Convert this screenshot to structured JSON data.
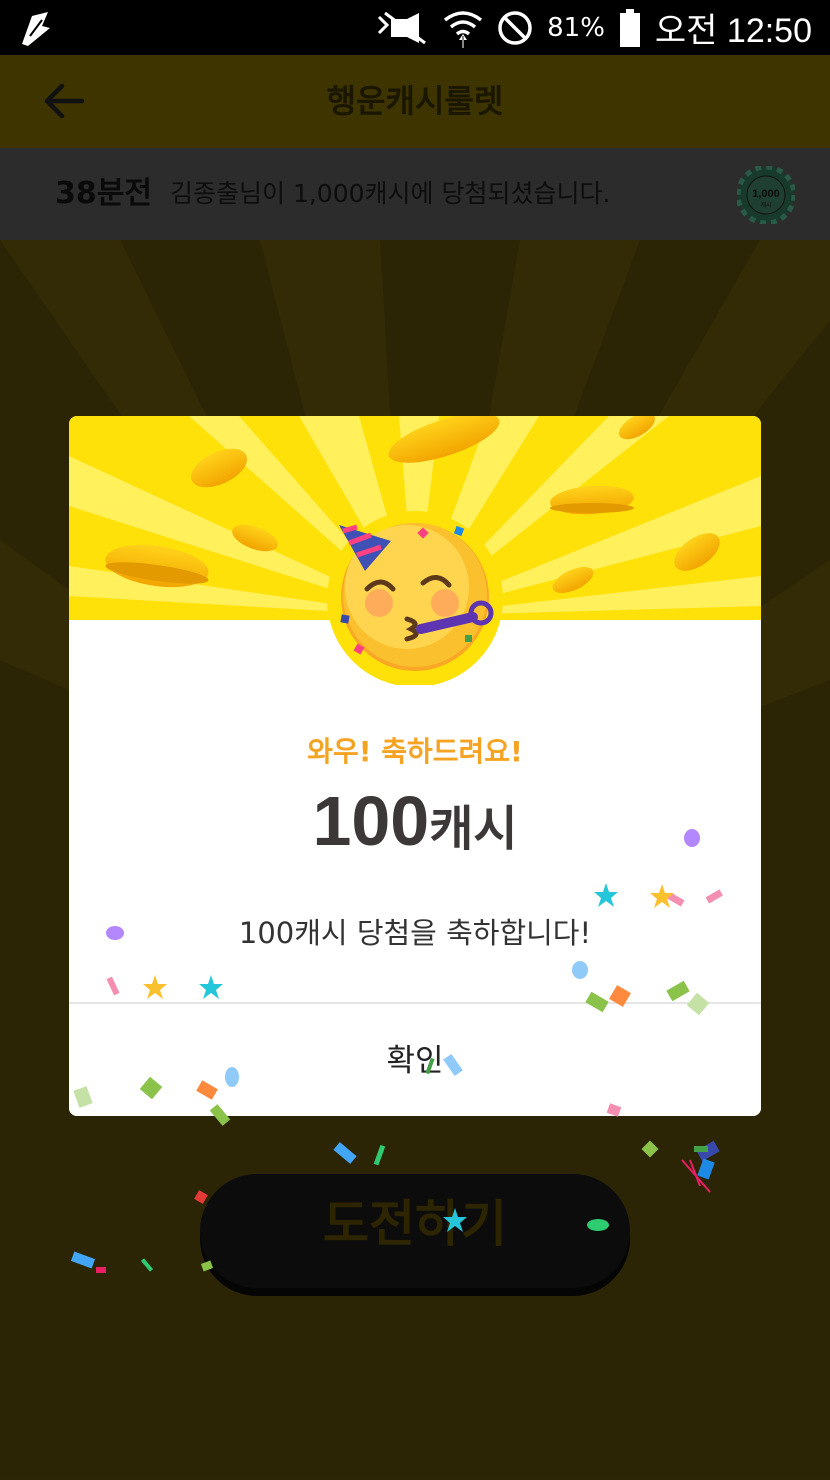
{
  "status_bar": {
    "battery": "81%",
    "time": "오전 12:50"
  },
  "app_bar": {
    "title": "행운캐시룰렛"
  },
  "ticker": {
    "time_ago": "38분전",
    "message": "김종출님이 1,000캐시에 당첨되셨습니다.",
    "badge_amount": "1,000",
    "badge_unit": "캐시"
  },
  "dialog": {
    "headline": "와우! 축하드려요!",
    "amount_number": "100",
    "amount_unit": "캐시",
    "description": "100캐시 당첨을 축하합니다!",
    "confirm_label": "확인"
  },
  "challenge_button": {
    "label": "도전하기"
  },
  "colors": {
    "accent_yellow": "#ffe000",
    "headline_orange": "#f5a322",
    "dim_overlay": "#2c2506"
  },
  "icons": [
    "notification-icon",
    "mute-icon",
    "wifi-icon",
    "do-not-disturb-icon",
    "battery-icon",
    "back-arrow-icon",
    "coin-badge-icon",
    "party-face-icon"
  ]
}
